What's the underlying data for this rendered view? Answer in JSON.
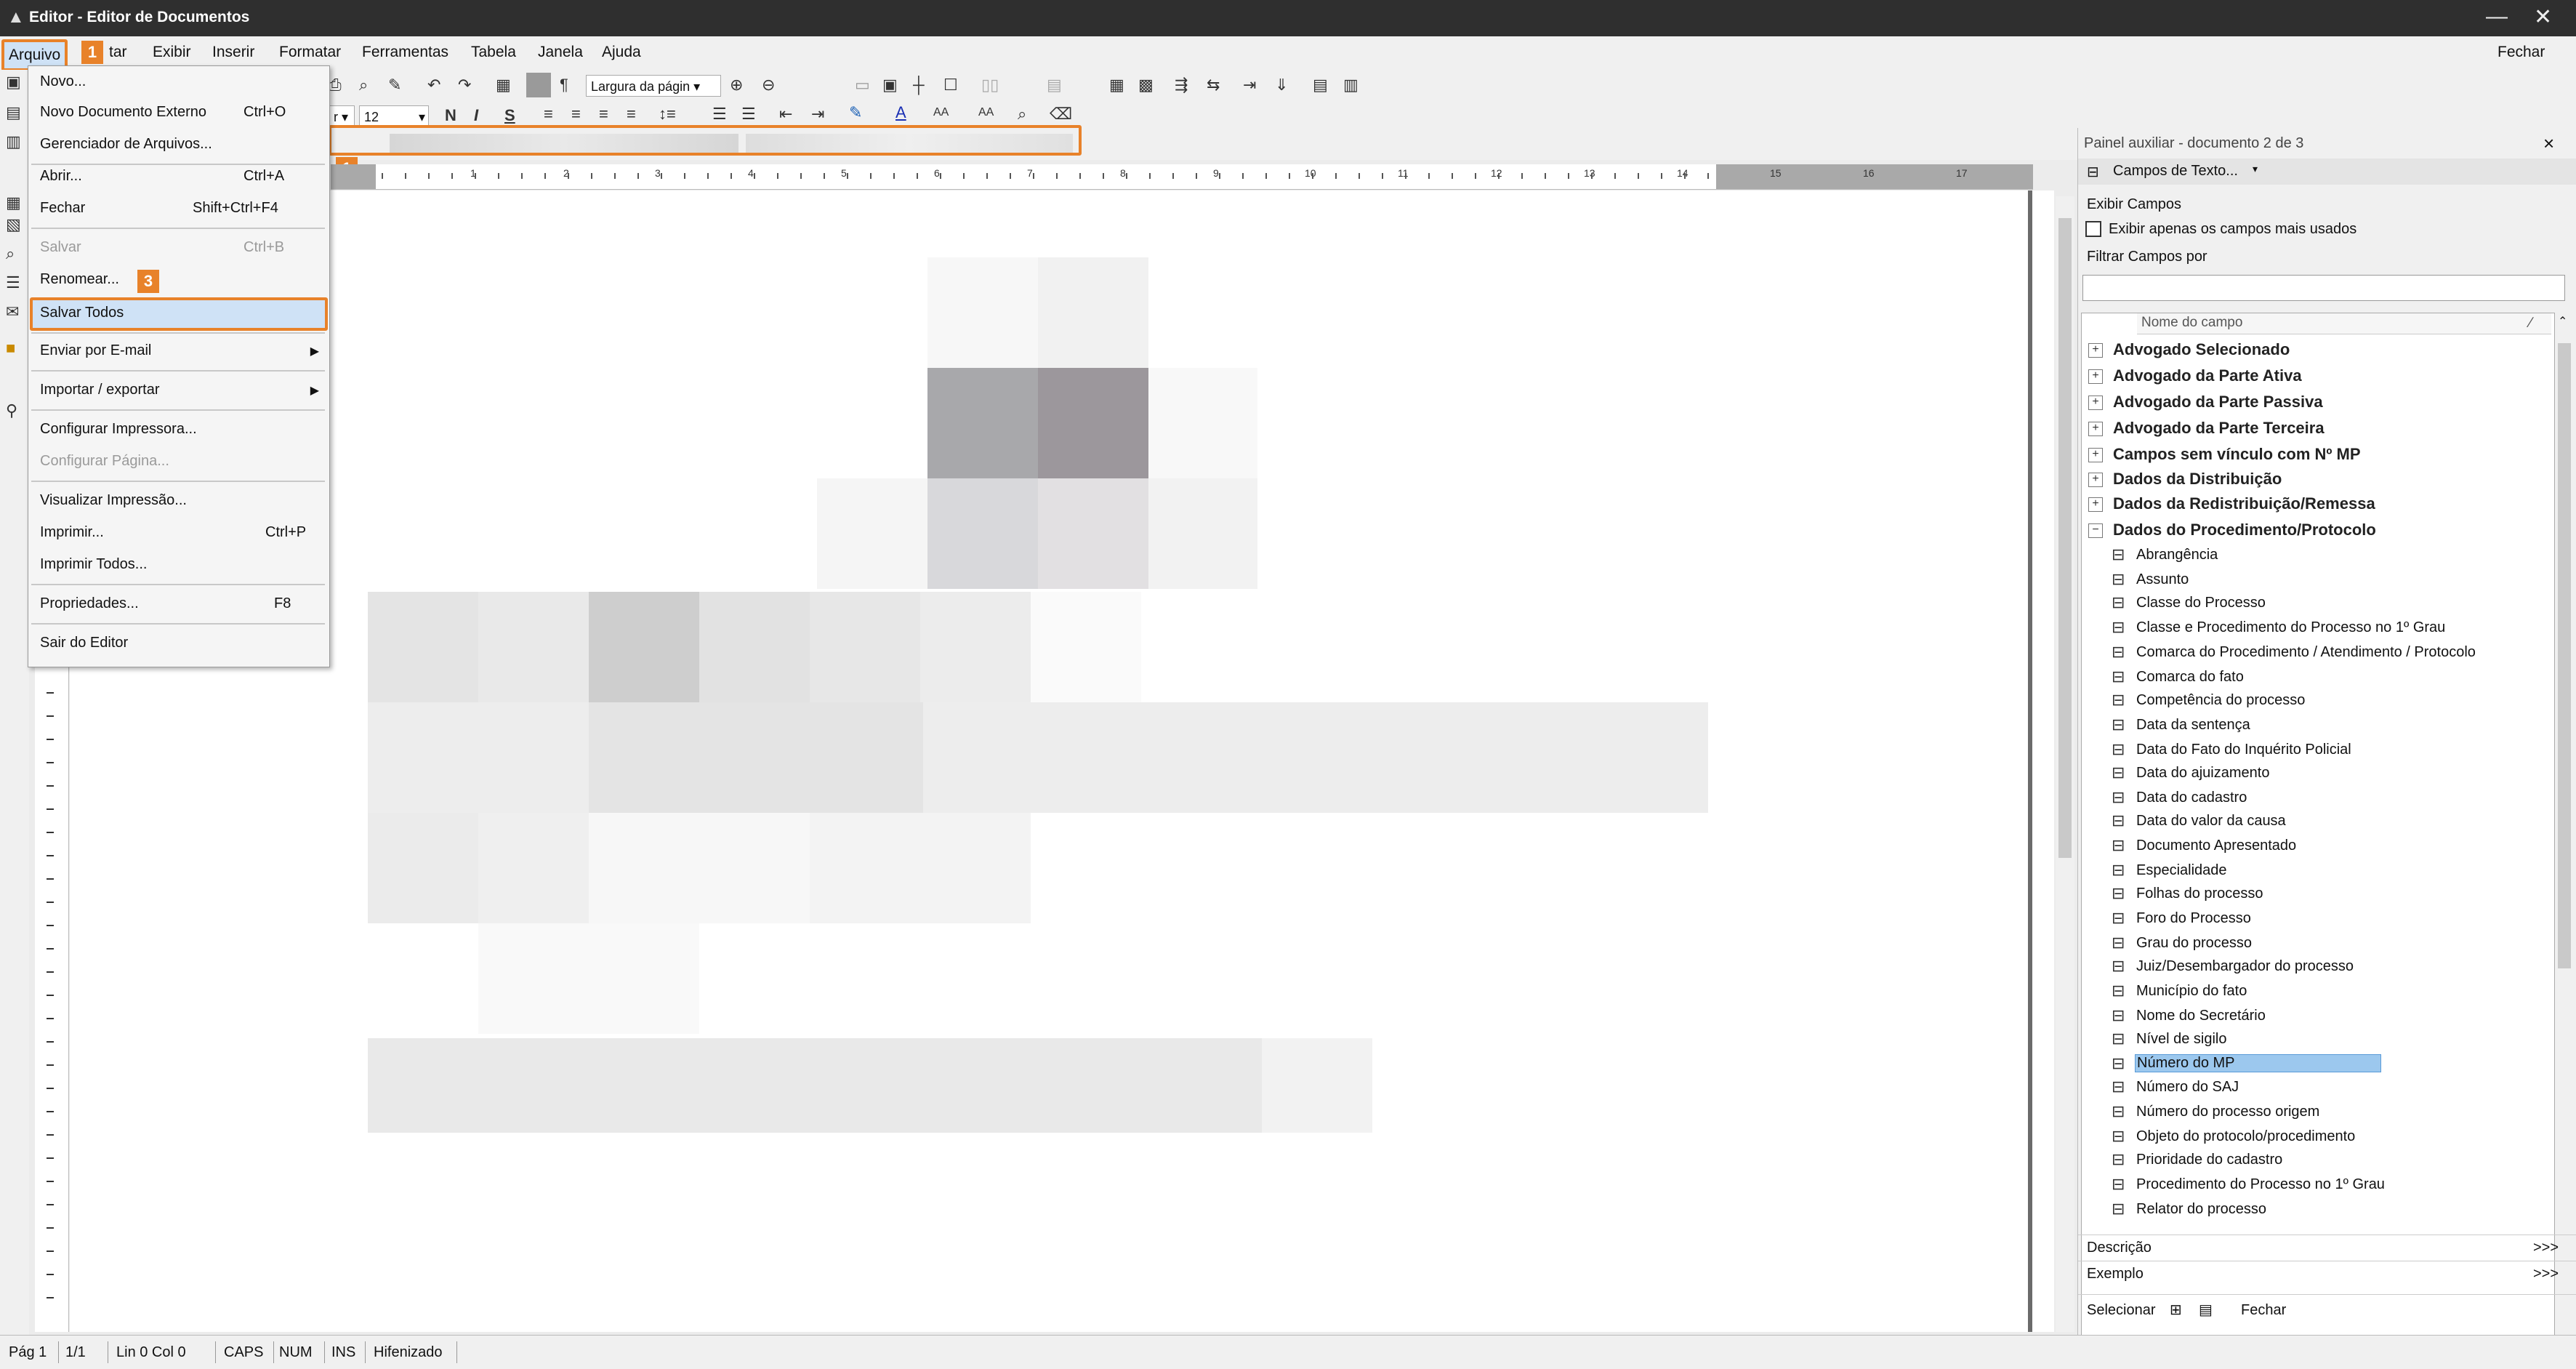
{
  "window": {
    "title": "Editor - Editor de Documentos",
    "minimize": "—",
    "close": "✕"
  },
  "menubar": {
    "items": [
      "Arquivo",
      "Editar",
      "Exibir",
      "Inserir",
      "Formatar",
      "Ferramentas",
      "Tabela",
      "Janela",
      "Ajuda"
    ],
    "right": "Fechar"
  },
  "badges": {
    "b1": "1",
    "b1b": "1",
    "b3": "3"
  },
  "toolbar": {
    "zoom": "Largura da págin",
    "font_size": "12",
    "bold": "N",
    "italic": "I",
    "underline": "S"
  },
  "filemenu": {
    "items": [
      {
        "label": "Novo...",
        "shortcut": ""
      },
      {
        "label": "Novo Documento Externo",
        "shortcut": "Ctrl+O"
      },
      {
        "label": "Gerenciador de Arquivos...",
        "shortcut": ""
      },
      {
        "label": "Abrir...",
        "shortcut": "Ctrl+A"
      },
      {
        "label": "Fechar",
        "shortcut": "Shift+Ctrl+F4"
      },
      {
        "label": "Salvar",
        "shortcut": "Ctrl+B"
      },
      {
        "label": "Renomear...",
        "shortcut": ""
      },
      {
        "label": "Salvar Todos",
        "shortcut": ""
      },
      {
        "label": "Enviar por E-mail",
        "shortcut": ""
      },
      {
        "label": "Importar / exportar",
        "shortcut": ""
      },
      {
        "label": "Configurar Impressora...",
        "shortcut": ""
      },
      {
        "label": "Configurar Página...",
        "shortcut": ""
      },
      {
        "label": "Visualizar Impressão...",
        "shortcut": ""
      },
      {
        "label": "Imprimir...",
        "shortcut": "Ctrl+P"
      },
      {
        "label": "Imprimir Todos...",
        "shortcut": ""
      },
      {
        "label": "Propriedades...",
        "shortcut": "F8"
      },
      {
        "label": "Sair do Editor",
        "shortcut": ""
      }
    ]
  },
  "ruler": {
    "numbers": [
      "1",
      "2",
      "3",
      "4",
      "5",
      "6",
      "7",
      "8",
      "9",
      "10",
      "11",
      "12",
      "13",
      "14",
      "15",
      "16",
      "17"
    ]
  },
  "panel": {
    "title": "Painel auxiliar - documento 2 de 3",
    "close": "×",
    "fields_button": "Campos de Texto...",
    "show_fields": "Exibir Campos",
    "only_most_used": "Exibir apenas os campos mais usados",
    "filter_label": "Filtrar Campos por",
    "filter_value": "",
    "column": "Nome do campo",
    "groups": [
      "Advogado Selecionado",
      "Advogado da Parte Ativa",
      "Advogado da Parte Passiva",
      "Advogado da Parte Terceira",
      "Campos sem vínculo com Nº MP",
      "Dados da Distribuição",
      "Dados da Redistribuição/Remessa",
      "Dados do Procedimento/Protocolo"
    ],
    "fields": [
      "Abrangência",
      "Assunto",
      "Classe do Processo",
      "Classe e Procedimento do Processo no 1º Grau",
      "Comarca do Procedimento / Atendimento / Protocolo",
      "Comarca do fato",
      "Competência do processo",
      "Data da sentença",
      "Data do Fato do Inquérito Policial",
      "Data do ajuizamento",
      "Data do cadastro",
      "Data do valor da causa",
      "Documento Apresentado",
      "Especialidade",
      "Folhas do processo",
      "Foro do Processo",
      "Grau do processo",
      "Juiz/Desembargador do processo",
      "Município do fato",
      "Nome do Secretário",
      "Nível de sigilo",
      "Número do MP",
      "Número do SAJ",
      "Número do processo origem",
      "Objeto do protocolo/procedimento",
      "Prioridade do cadastro",
      "Procedimento do Processo no 1º Grau",
      "Relator do processo"
    ],
    "selected_field": "Número do MP",
    "description": "Descrição",
    "example": "Exemplo",
    "more": ">>>",
    "select": "Selecionar",
    "close_btn": "Fechar"
  },
  "statusbar": {
    "page": "Pág 1",
    "pages": "1/1",
    "pos": "Lin 0  Col 0",
    "caps": "CAPS",
    "num": "NUM",
    "ins": "INS",
    "hyph": "Hifenizado"
  }
}
